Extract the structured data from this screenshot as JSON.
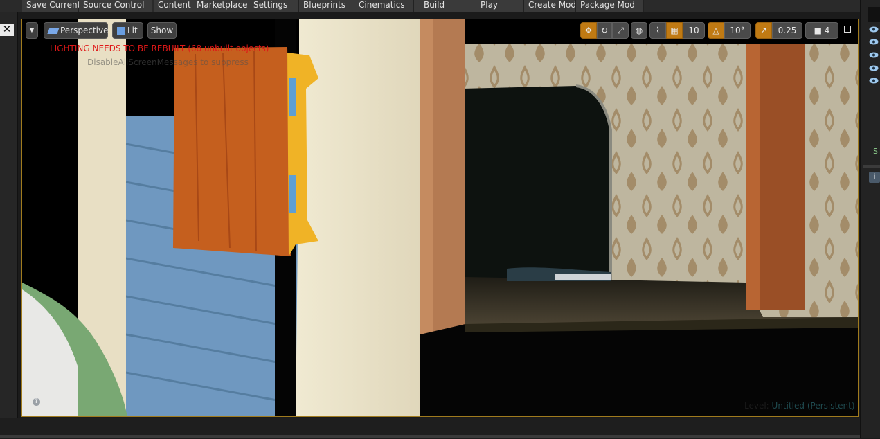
{
  "toolbar": {
    "items": [
      "Save Current",
      "Source Control",
      "Content",
      "Marketplace",
      "Settings",
      "Blueprints",
      "Cinematics",
      "Build",
      "Play",
      "Create Mod",
      "Package Mod"
    ]
  },
  "viewport": {
    "perspective_label": "Perspective",
    "lit_label": "Lit",
    "show_label": "Show",
    "grid_snap": "10",
    "rotation_snap": "10°",
    "scale_snap": "0.25",
    "camera_speed": "4",
    "lighting_warning": "LIGHTING NEEDS TO BE REBUILT (68 unbuilt objects)",
    "screen_message": "DisableAllScreenMessages to suppress",
    "level_prefix": "Level:",
    "level_name": "Untitled (Persistent)"
  },
  "colors": {
    "accent": "#c07a13",
    "warning": "#e01818",
    "viewport_border": "#a07b1e"
  }
}
